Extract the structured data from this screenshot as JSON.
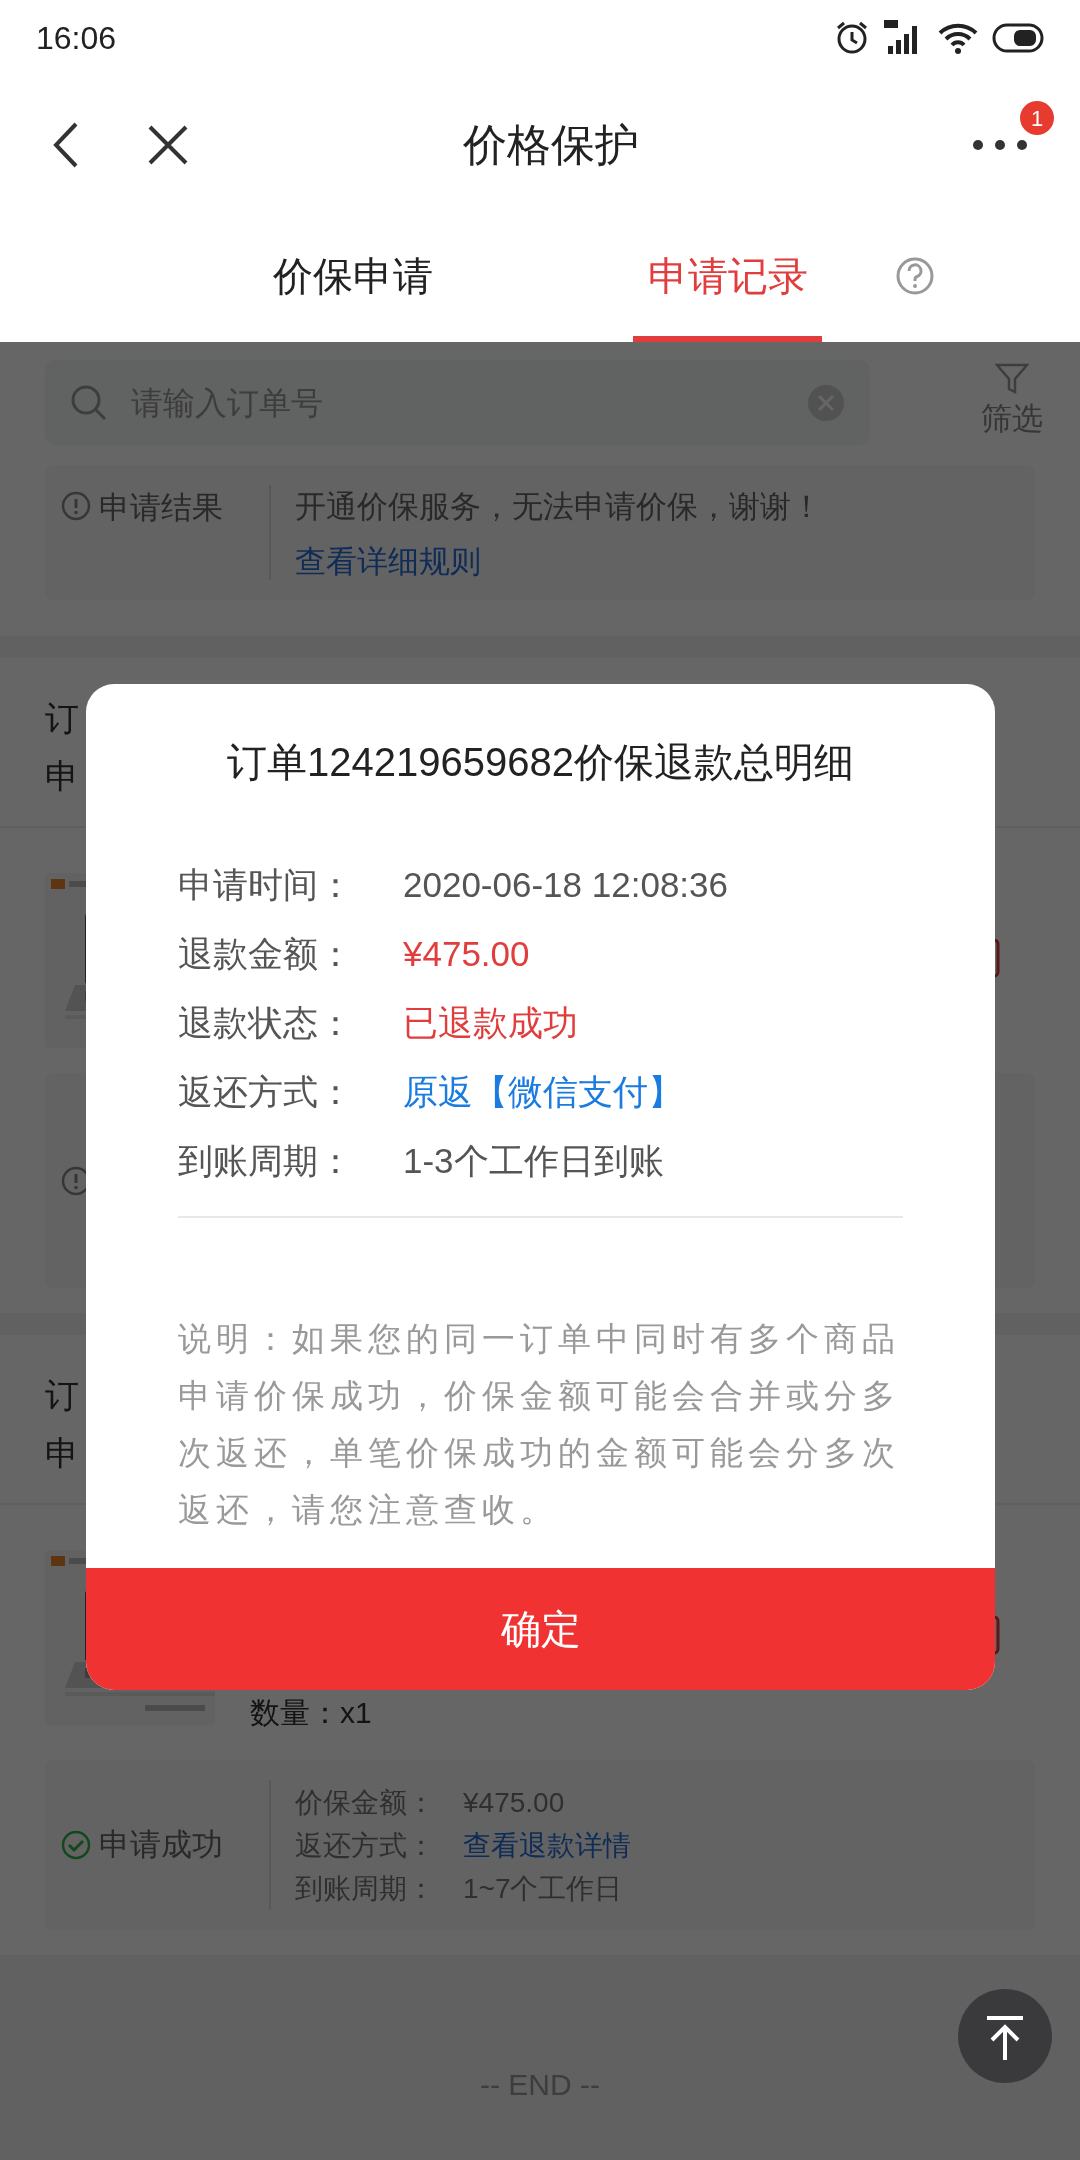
{
  "status_bar": {
    "time": "16:06"
  },
  "nav": {
    "title": "价格保护",
    "menu_badge": "1"
  },
  "tabs": [
    {
      "label": "价保申请",
      "selected": false
    },
    {
      "label": "申请记录",
      "selected": true
    }
  ],
  "search": {
    "placeholder": "请输入订单号"
  },
  "filter": {
    "label": "筛选"
  },
  "notice": {
    "label": "申请结果",
    "text": "开通价保服务，无法申请价保，谢谢！",
    "link": "查看详细规则"
  },
  "orders": [
    {
      "line_1": "订",
      "line_2": "申",
      "result": {
        "kind": "warning"
      }
    },
    {
      "line_1": "订",
      "line_2": "申",
      "product": {
        "kind": "picture",
        "quantity": "数量：x1"
      },
      "result": {
        "kind": "success",
        "label": "申请成功",
        "lines": [
          {
            "label": "价保金额：",
            "value": "¥475.00",
            "kind": "plain"
          },
          {
            "label": "返还方式：",
            "value": "查看退款详情",
            "kind": "link"
          },
          {
            "label": "到账周期：",
            "value": "1~7个工作日",
            "kind": "plain"
          }
        ]
      }
    }
  ],
  "end_text": "-- END --",
  "dialog": {
    "title": "订单124219659682价保退款总明细",
    "rows": [
      {
        "label": "申请时间：",
        "value": "2020-06-18 12:08:36",
        "kind": "plain"
      },
      {
        "label": "退款金额：",
        "value": "¥475.00",
        "kind": "alert"
      },
      {
        "label": "退款状态：",
        "value": "已退款成功",
        "kind": "alert"
      },
      {
        "label": "返还方式：",
        "value": "原返【微信支付】",
        "kind": "link"
      },
      {
        "label": "到账周期：",
        "value": "1-3个工作日到账",
        "kind": "plain"
      }
    ],
    "note": "说明：如果您的同一订单中同时有多个商品申请价保成功，价保金额可能会合并或分多次返还，单笔价保成功的金额可能会分多次返还，请您注意查收。",
    "button": "确定"
  }
}
